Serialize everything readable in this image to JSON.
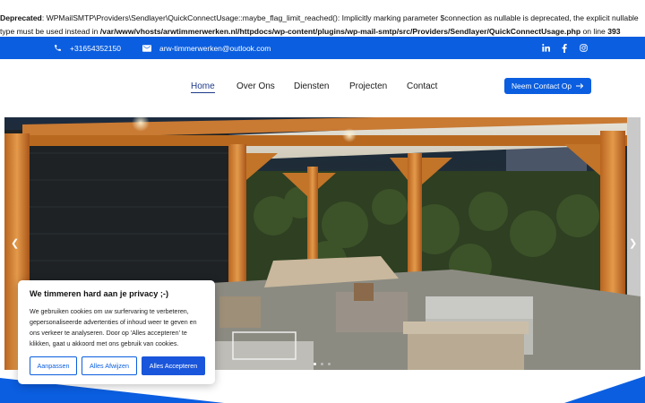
{
  "notice": {
    "label": "Deprecated",
    "text1": ": WPMailSMTP\\Providers\\Sendlayer\\QuickConnectUsage::maybe_flag_limit_reached(): Implicitly marking parameter $connection as nullable is deprecated, the explicit nullable type must be used instead in ",
    "path": "/var/www/vhosts/arwtimmerwerken.nl/httpdocs/wp-content/plugins/wp-mail-smtp/src/Providers/Sendlayer/QuickConnectUsage.php",
    "text2": " on line ",
    "line": "393"
  },
  "topbar": {
    "phone": "+31654352150",
    "email": "arw-timmerwerken@outlook.com",
    "phone_icon": "phone-icon",
    "email_icon": "envelope-icon",
    "social": [
      "linkedin-icon",
      "facebook-icon",
      "instagram-icon"
    ],
    "bg": "#0b5ee0"
  },
  "nav": {
    "items": [
      "Home",
      "Over Ons",
      "Diensten",
      "Projecten",
      "Contact"
    ],
    "active": "Home",
    "cta": "Neem Contact Op"
  },
  "slider": {
    "prev_icon": "chevron-left-icon",
    "next_icon": "chevron-right-icon",
    "slide_count": 3,
    "active_slide": 1
  },
  "cookie": {
    "title": "We timmeren hard aan je privacy ;-)",
    "body": "We gebruiken cookies om uw surfervaring te verbeteren, gepersonaliseerde advertenties of inhoud weer te geven en ons verkeer te analyseren. Door op 'Alles accepteren' te klikken, gaat u akkoord met ons gebruik van cookies.",
    "customize": "Aanpassen",
    "reject": "Alles Afwijzen",
    "accept": "Alles Accepteren"
  },
  "colors": {
    "brand": "#0b5ee0",
    "accept": "#1a56db"
  }
}
